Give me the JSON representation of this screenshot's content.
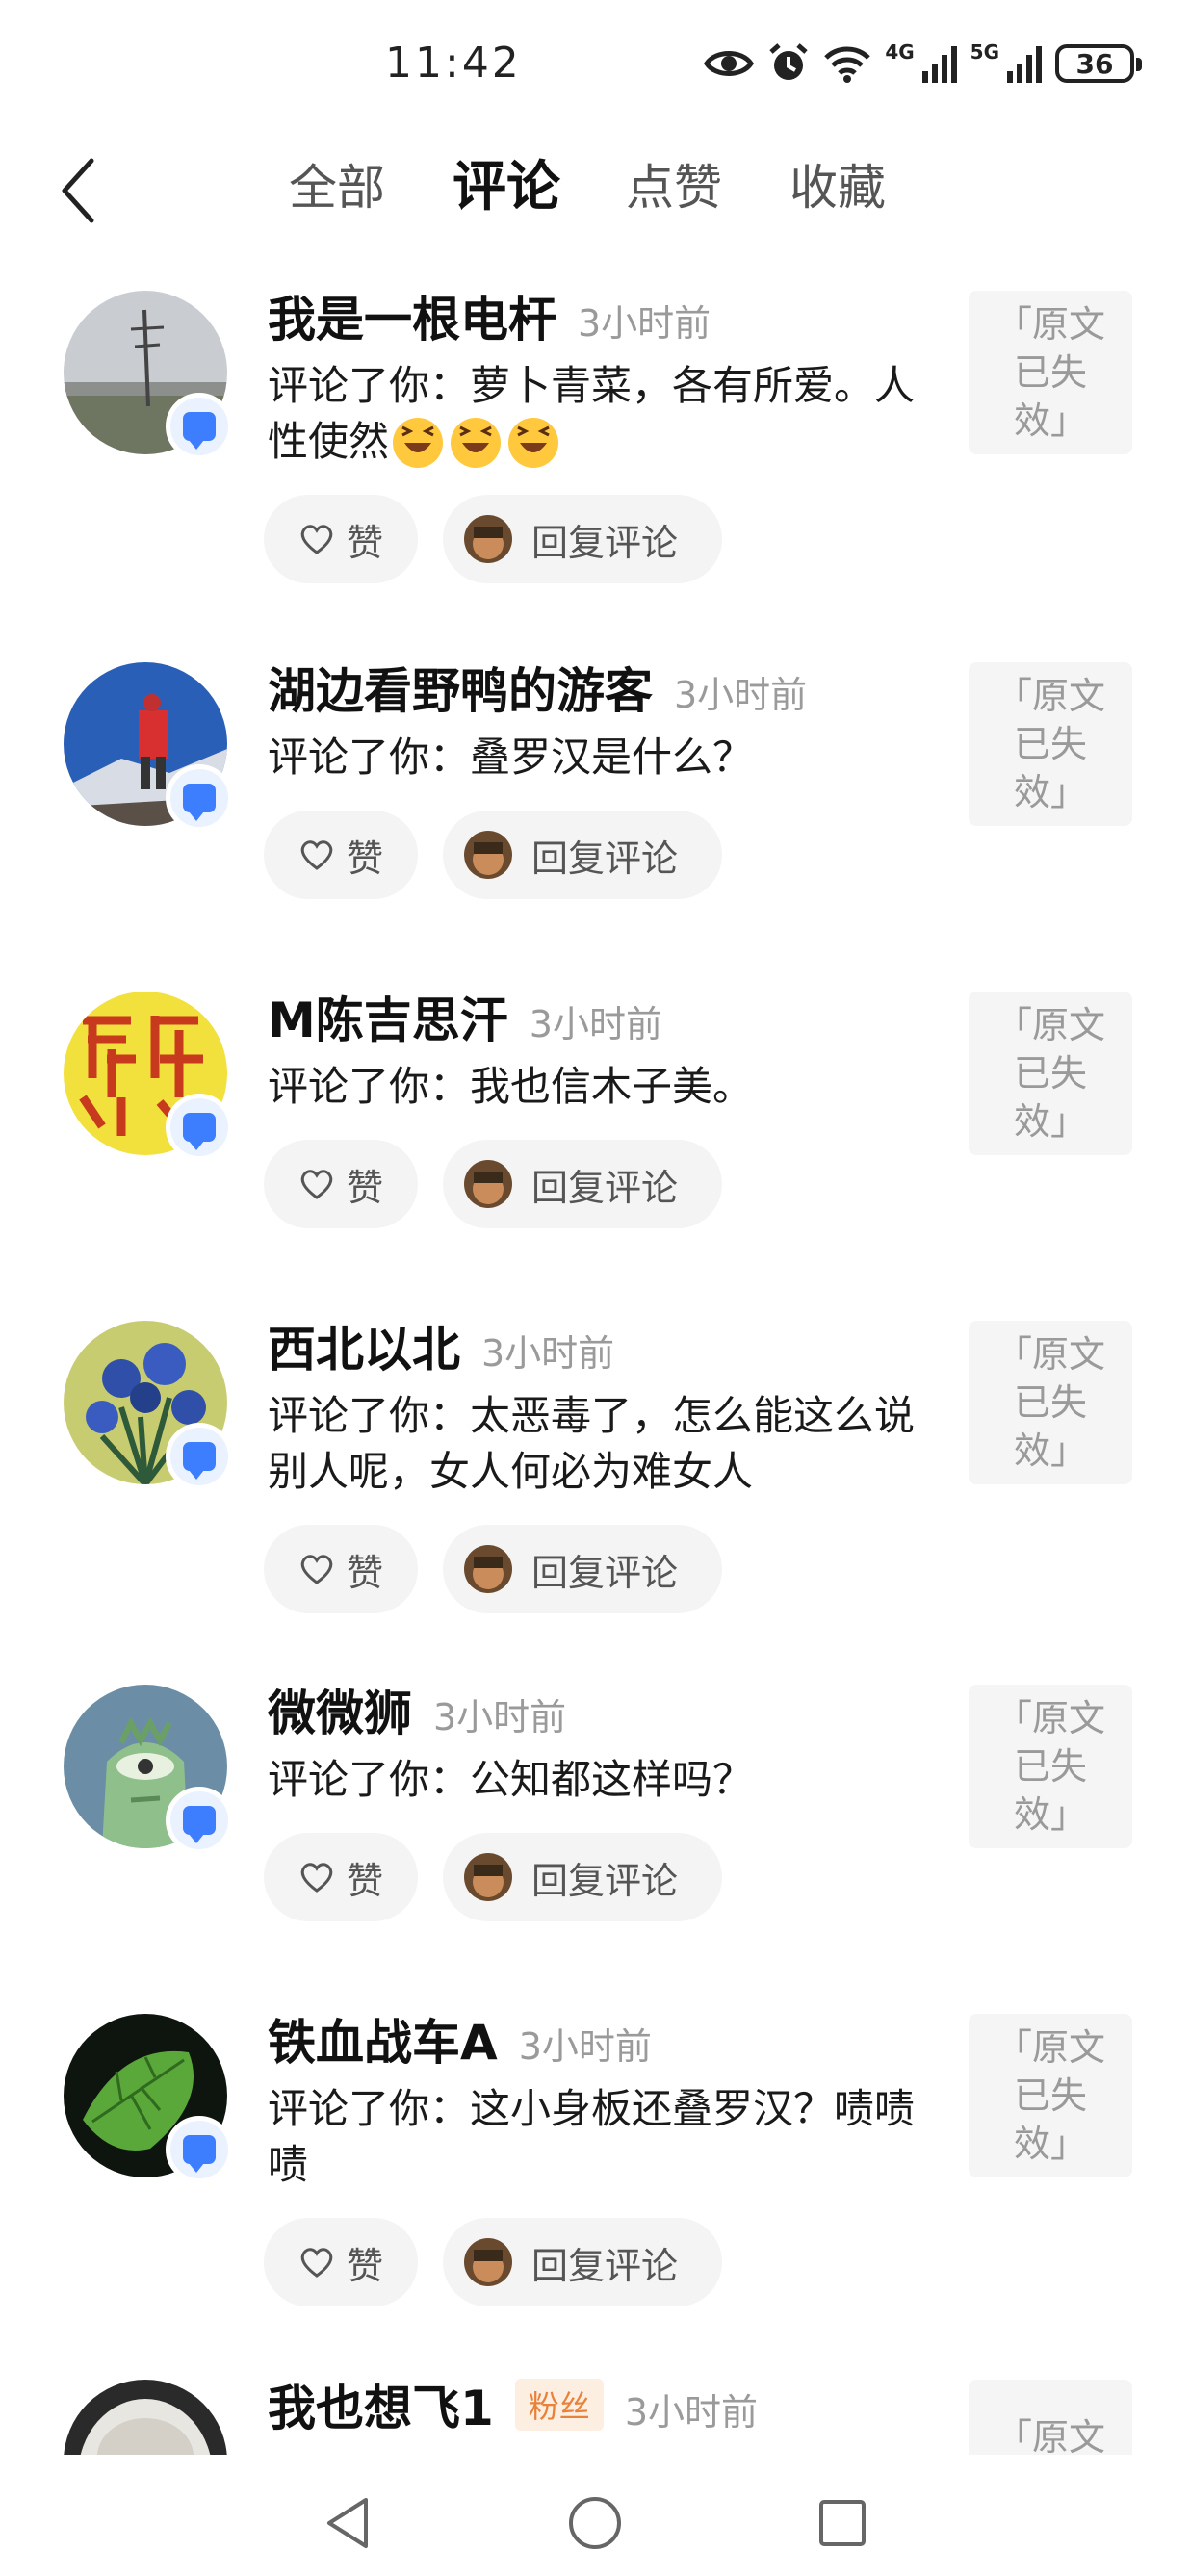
{
  "status_bar": {
    "time": "11:42",
    "network_1": "4G",
    "network_2": "5G",
    "battery": "36",
    "icons": [
      "eye-icon",
      "alarm-icon",
      "wifi-icon",
      "signal-icon",
      "signal-icon",
      "battery-icon"
    ]
  },
  "header": {
    "back_icon": "chevron-left-icon",
    "tabs": [
      {
        "label": "全部",
        "active": false
      },
      {
        "label": "评论",
        "active": true
      },
      {
        "label": "点赞",
        "active": false
      },
      {
        "label": "收藏",
        "active": false
      }
    ]
  },
  "notifications": [
    {
      "name": "我是一根电杆",
      "time": "3小时前",
      "comment": "评论了你：萝卜青菜，各有所爱。人性使然",
      "emojis": 3,
      "like_label": "赞",
      "reply_label": "回复评论",
      "original": "「原文已失效」"
    },
    {
      "name": "湖边看野鸭的游客",
      "time": "3小时前",
      "comment": "评论了你：叠罗汉是什么？",
      "like_label": "赞",
      "reply_label": "回复评论",
      "original": "「原文已失效」"
    },
    {
      "name": "M陈吉思汗",
      "time": "3小时前",
      "comment": "评论了你：我也信木子美。",
      "like_label": "赞",
      "reply_label": "回复评论",
      "original": "「原文已失效」"
    },
    {
      "name": "西北以北",
      "time": "3小时前",
      "comment": "评论了你：太恶毒了，怎么能这么说别人呢，女人何必为难女人",
      "like_label": "赞",
      "reply_label": "回复评论",
      "original": "「原文已失效」"
    },
    {
      "name": "微微狮",
      "time": "3小时前",
      "comment": "评论了你：公知都这样吗？",
      "like_label": "赞",
      "reply_label": "回复评论",
      "original": "「原文已失效」"
    },
    {
      "name": "铁血战车A",
      "time": "3小时前",
      "comment": "评论了你：这小身板还叠罗汉？啧啧啧",
      "like_label": "赞",
      "reply_label": "回复评论",
      "original": "「原文已失效」"
    },
    {
      "name": "我也想飞1",
      "badge": "粉丝",
      "time": "3小时前",
      "original": "「原文已"
    }
  ],
  "colors": {
    "accent": "#3d7eff",
    "fans_badge": "#e8823a",
    "muted": "#9a9a9a"
  },
  "nav_bar": {
    "icons": [
      "back-triangle-icon",
      "home-circle-icon",
      "recents-square-icon"
    ]
  }
}
